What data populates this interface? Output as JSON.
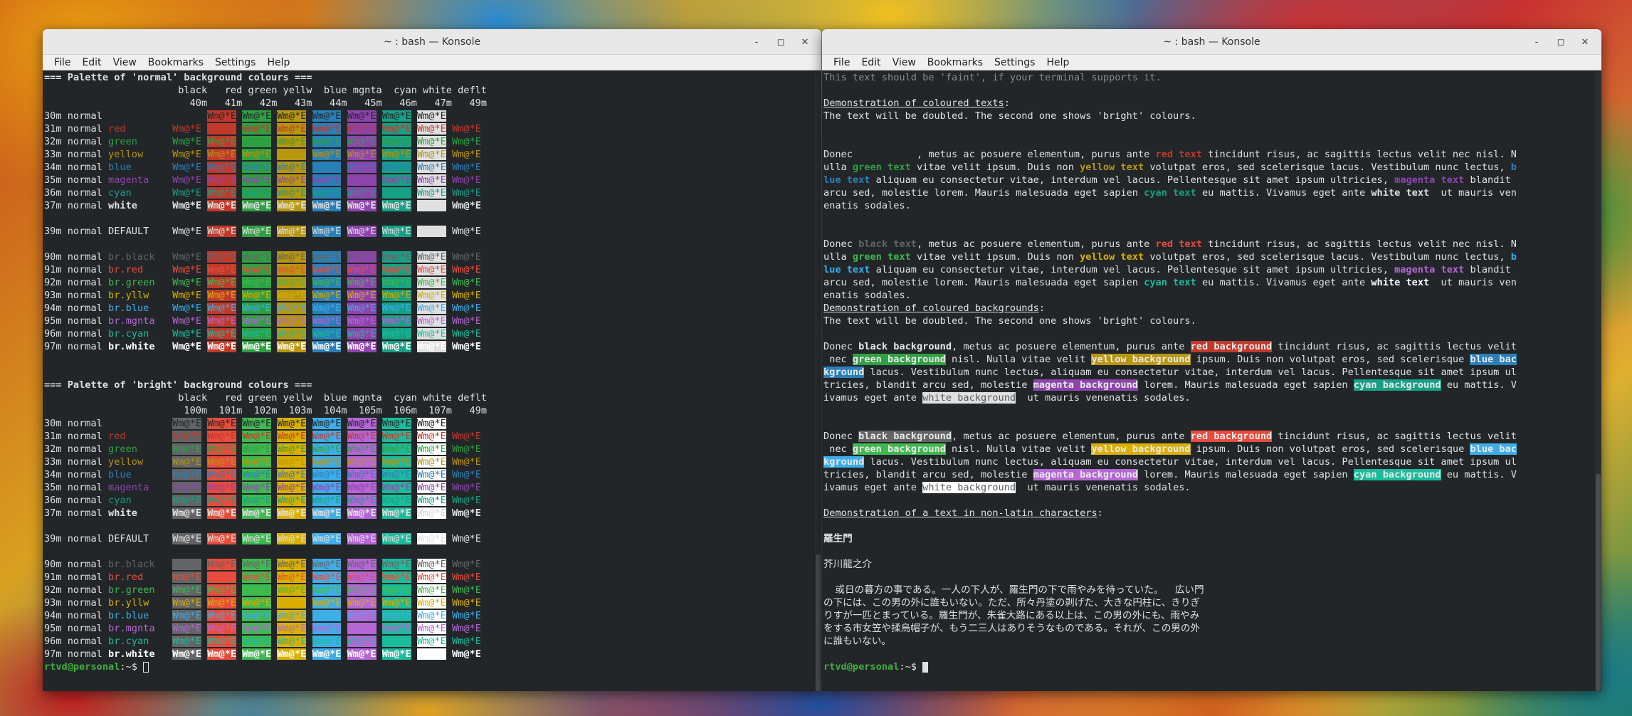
{
  "windows": [
    {
      "title": "~ : bash — Konsole",
      "window_buttons": [
        "-",
        "◻",
        "✕"
      ],
      "menu": [
        "File",
        "Edit",
        "View",
        "Bookmarks",
        "Settings",
        "Help"
      ]
    },
    {
      "title": "~ : bash — Konsole",
      "window_buttons": [
        "-",
        "◻",
        "✕"
      ],
      "menu": [
        "File",
        "Edit",
        "View",
        "Bookmarks",
        "Settings",
        "Help"
      ]
    }
  ],
  "colors": {
    "terminal_bg": "#232629",
    "prompt_user": "#3daf3d",
    "palette": {
      "black": "#232629",
      "red": "#c0392b",
      "green": "#2ea043",
      "yellow": "#b8960f",
      "blue": "#2980b9",
      "magenta": "#8e44ad",
      "cyan": "#16a085",
      "white": "#e0e0e0",
      "br.black": "#626466",
      "br.red": "#e74c3c",
      "br.green": "#3fb950",
      "br.yellow": "#d9b000",
      "br.blue": "#3daee9",
      "br.magenta": "#b567d6",
      "br.cyan": "#1abc9c",
      "br.white": "#ffffff"
    }
  },
  "left": {
    "heading_normal": "=== Palette of 'normal' background colours ===",
    "heading_bright": "=== Palette of 'bright' background colours ===",
    "col_headers": [
      "black",
      "red",
      "green",
      "yellw",
      "blue",
      "mgnta",
      "cyan",
      "white",
      "deflt"
    ],
    "normal_codes": [
      "40m",
      "41m",
      "42m",
      "43m",
      "44m",
      "45m",
      "46m",
      "47m",
      "49m"
    ],
    "bright_codes": [
      "100m",
      "101m",
      "102m",
      "103m",
      "104m",
      "105m",
      "106m",
      "107m",
      "49m"
    ],
    "sample": "Wm@*E",
    "rows_a": [
      [
        "30m",
        "normal",
        "black"
      ],
      [
        "31m",
        "normal",
        "red"
      ],
      [
        "32m",
        "normal",
        "green"
      ],
      [
        "33m",
        "normal",
        "yellow"
      ],
      [
        "34m",
        "normal",
        "blue"
      ],
      [
        "35m",
        "normal",
        "magenta"
      ],
      [
        "36m",
        "normal",
        "cyan"
      ],
      [
        "37m",
        "normal",
        "white"
      ]
    ],
    "row_default": [
      "39m",
      "normal",
      "DEFAULT"
    ],
    "rows_b": [
      [
        "90m",
        "normal",
        "br.black"
      ],
      [
        "91m",
        "normal",
        "br.red"
      ],
      [
        "92m",
        "normal",
        "br.green"
      ],
      [
        "93m",
        "normal",
        "br.yllw"
      ],
      [
        "94m",
        "normal",
        "br.blue"
      ],
      [
        "95m",
        "normal",
        "br.mgnta"
      ],
      [
        "96m",
        "normal",
        "br.cyan"
      ],
      [
        "97m",
        "normal",
        "br.white"
      ]
    ],
    "prompt_user": "rtvd@personal",
    "prompt_rest": ":~$ "
  },
  "right": {
    "faint_line": "This text should be 'faint', if your terminal supports it.",
    "h_texts": "Demonstration of coloured texts",
    "doubled_note": "The text will be doubled. The second one shows 'bright' colours.",
    "texts_para": [
      [
        "Donec ",
        {
          "c": "black",
          "t": "black text"
        },
        ", metus ac posuere elementum, purus ante ",
        {
          "c": "red",
          "t": "red text"
        },
        " tincidunt risus, ac sagittis lectus velit nec nisl. N"
      ],
      [
        "ulla ",
        {
          "c": "green",
          "t": "green text"
        },
        " vitae velit ipsum. Duis non ",
        {
          "c": "yellow",
          "t": "yellow text"
        },
        " volutpat eros, sed scelerisque lacus. Vestibulum nunc lectus, ",
        {
          "c": "blue",
          "t": "b"
        }
      ],
      [
        {
          "c": "blue",
          "t": "lue text"
        },
        " aliquam eu consectetur vitae, interdum vel lacus. Pellentesque sit amet ipsum ultricies, ",
        {
          "c": "magenta",
          "t": "magenta text"
        },
        " blandit"
      ],
      [
        "arcu sed, molestie lorem. Mauris malesuada eget sapien ",
        {
          "c": "cyan",
          "t": "cyan text"
        },
        " eu mattis. Vivamus eget ante ",
        {
          "c": "white",
          "t": "white text"
        },
        "  ut mauris ven"
      ],
      [
        "enatis sodales."
      ]
    ],
    "h_backgrounds": "Demonstration of coloured backgrounds",
    "bg_para": [
      [
        "Donec ",
        {
          "c": "black",
          "t": "black background"
        },
        ", metus ac posuere elementum, purus ante ",
        {
          "c": "red",
          "t": "red background"
        },
        " tincidunt risus, ac sagittis lectus velit"
      ],
      [
        " nec ",
        {
          "c": "green",
          "t": "green background"
        },
        " nisl. Nulla vitae velit ",
        {
          "c": "yellow",
          "t": "yellow background"
        },
        " ipsum. Duis non volutpat eros, sed scelerisque ",
        {
          "c": "blue",
          "t": "blue bac"
        }
      ],
      [
        {
          "c": "blue",
          "t": "kground"
        },
        " lacus. Vestibulum nunc lectus, aliquam eu consectetur vitae, interdum vel lacus. Pellentesque sit amet ipsum ul"
      ],
      [
        "tricies, blandit arcu sed, molestie ",
        {
          "c": "magenta",
          "t": "magenta background"
        },
        " lorem. Mauris malesuada eget sapien ",
        {
          "c": "cyan",
          "t": "cyan background"
        },
        " eu mattis. V"
      ],
      [
        "ivamus eget ante ",
        {
          "c": "white",
          "t": "white background"
        },
        "  ut mauris venenatis sodales."
      ]
    ],
    "h_nonlatin": "Demonstration of a text in non-latin characters",
    "jp_title": "羅生門",
    "jp_author": "芥川龍之介",
    "jp_lines": [
      "  或日の暮方の事である。一人の下人が、羅生門の下で雨やみを待っていた。  広い門",
      "の下には、この男の外に誰もいない。ただ、所々丹塗の剥げた、大きな円柱に、きりぎ",
      "りすが一匹とまっている。羅生門が、朱雀大路にある以上は、この男の外にも、雨やみ",
      "をする市女笠や揉烏帽子が、もう二三人はありそうなものである。それが、この男の外",
      "に誰もいない。"
    ],
    "prompt_user": "rtvd@personal",
    "prompt_rest": ":~$ "
  }
}
